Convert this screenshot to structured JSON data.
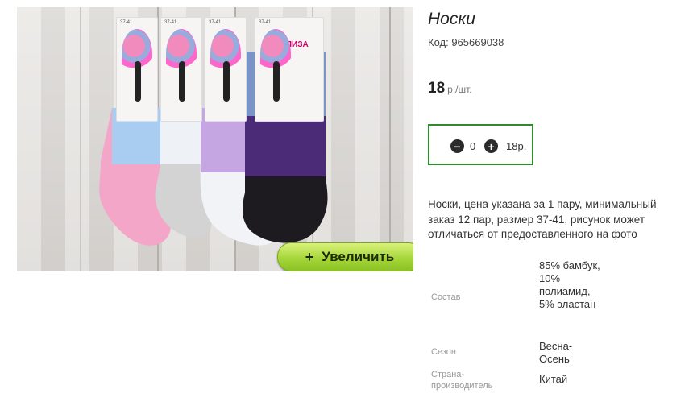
{
  "product": {
    "title": "Носки",
    "code": "Код: 965669038",
    "price_value": "18",
    "price_unit": "р./шт.",
    "description": "Носки, цена указана за 1 пару, минимальный заказ 12 пар, размер 37-41, рисунок может отличаться от предоставленного на фото"
  },
  "image": {
    "zoom_button_label": "Увеличить",
    "zoom_plus": "+",
    "card_size_text": "37-41",
    "card_brand_text": "ЛИЗА"
  },
  "quantity": {
    "minus": "−",
    "value": "0",
    "plus": "+",
    "sum": "18р."
  },
  "specs": [
    {
      "label": "Состав",
      "value": "85% бамбук, 10% полиамид, 5% эластан"
    },
    {
      "label": "Сезон",
      "value": "Весна-Осень"
    },
    {
      "label": "Страна-производитель",
      "value": "Китай"
    }
  ],
  "colors": {
    "qty_border": "#2e8b2e",
    "zoom_button": "#a6d63a"
  }
}
